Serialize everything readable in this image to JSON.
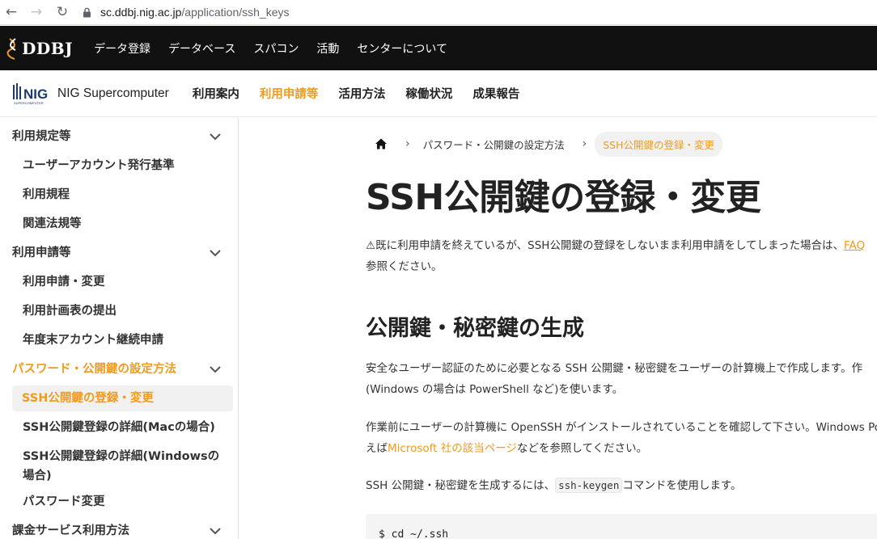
{
  "browser": {
    "url_host": "sc.ddbj.nig.ac.jp",
    "url_path": "/application/ssh_keys"
  },
  "ddbj": {
    "logo": "DDBJ",
    "nav": [
      "データ登録",
      "データベース",
      "スパコン",
      "活動",
      "センターについて"
    ]
  },
  "nig": {
    "logo_text": "NIG Supercomputer",
    "nav": [
      "利用案内",
      "利用申請等",
      "活用方法",
      "稼働状況",
      "成果報告"
    ],
    "active_index": 1
  },
  "sidebar": {
    "sections": [
      {
        "label": "利用規定等",
        "items": [
          "ユーザーアカウント発行基準",
          "利用規程",
          "関連法規等"
        ]
      },
      {
        "label": "利用申請等",
        "items": [
          "利用申請・変更",
          "利用計画表の提出",
          "年度末アカウント継続申請"
        ]
      },
      {
        "label": "パスワード・公開鍵の設定方法",
        "items": [
          "SSH公開鍵の登録・変更",
          "SSH公開鍵登録の詳細(Macの場合)",
          "SSH公開鍵登録の詳細(Windowsの",
          "場合)",
          "パスワード変更"
        ]
      },
      {
        "label": "課金サービス利用方法"
      }
    ]
  },
  "breadcrumb": {
    "parent": "パスワード・公開鍵の設定方法",
    "current": "SSH公開鍵の登録・変更"
  },
  "content": {
    "title": "SSH公開鍵の登録・変更",
    "warning_line1": "⚠既に利用申請を終えているが、SSH公開鍵の登録をしないまま利用申請をしてしまった場合は、",
    "warning_link": "FAQ",
    "warning_line2": "参照ください。",
    "section_title": "公開鍵・秘密鍵の生成",
    "p1_line1": "安全なユーザー認証のために必要となる SSH 公開鍵・秘密鍵をユーザーの計算機上で作成します。作",
    "p1_line2": "(Windows の場合は PowerShell など)を使います。",
    "p2_line1": "作業前にユーザーの計算機に OpenSSH がインストールされていることを確認して下さい。Windows Pow",
    "p2_prefix": "えば",
    "p2_link": "Microsoft 社の該当ページ",
    "p2_suffix": "などを参照してください。",
    "p3_prefix": "SSH 公開鍵・秘密鍵を生成するには、",
    "p3_code": "ssh-keygen",
    "p3_suffix": "コマンドを使用します。",
    "code_line": "$ cd ~/.ssh"
  },
  "colors": {
    "accent": "#f29a1a",
    "topbar": "#111111"
  }
}
